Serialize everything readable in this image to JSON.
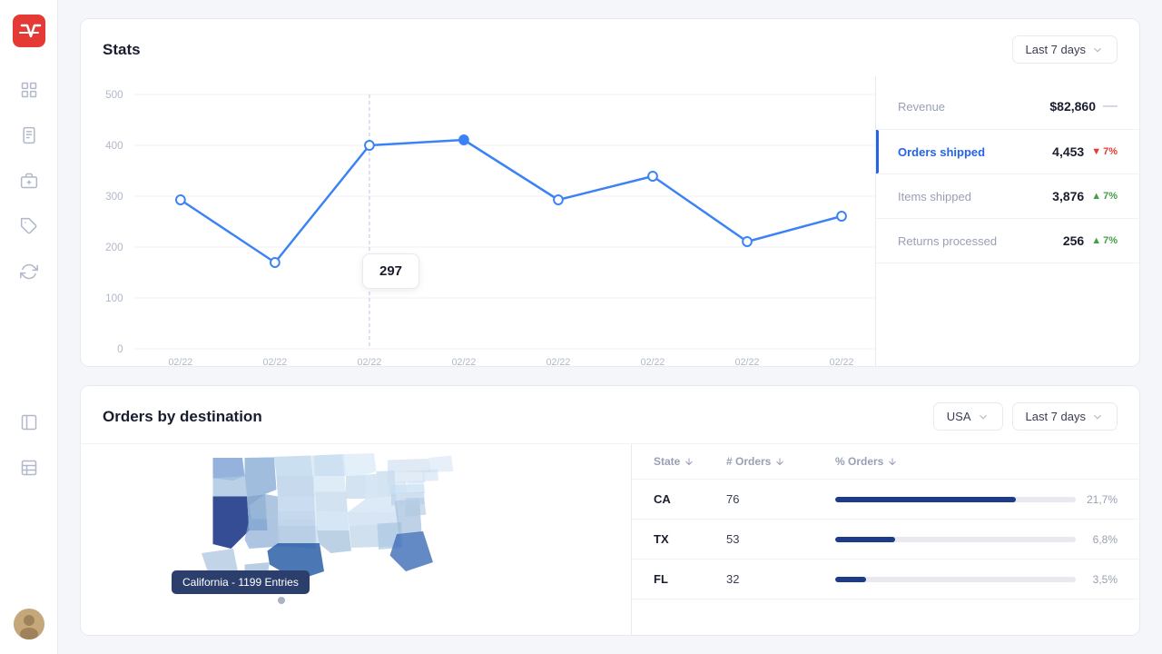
{
  "sidebar": {
    "logo_color": "#e53935",
    "items": [
      {
        "name": "dashboard-icon",
        "label": "Dashboard"
      },
      {
        "name": "orders-icon",
        "label": "Orders"
      },
      {
        "name": "inventory-icon",
        "label": "Inventory"
      },
      {
        "name": "tags-icon",
        "label": "Tags"
      },
      {
        "name": "refresh-icon",
        "label": "Sync"
      }
    ]
  },
  "stats": {
    "title": "Stats",
    "time_filter": "Last 7 days",
    "chart": {
      "y_labels": [
        "500",
        "400",
        "300",
        "200",
        "100",
        "0"
      ],
      "x_labels": [
        "02/22",
        "02/22",
        "02/22",
        "02/22",
        "02/22",
        "02/22",
        "02/22",
        "02/22"
      ],
      "data_points": [
        300,
        170,
        400,
        410,
        300,
        340,
        210,
        300,
        260
      ],
      "tooltip_value": "297",
      "tooltip_visible": true
    },
    "metrics": [
      {
        "name": "revenue",
        "label": "Revenue",
        "value": "$82,860",
        "badge": null,
        "badge_type": null,
        "active": false,
        "has_dash": true
      },
      {
        "name": "orders-shipped",
        "label": "Orders shipped",
        "value": "4,453",
        "badge": "7%",
        "badge_type": "down",
        "active": true,
        "has_dash": false
      },
      {
        "name": "items-shipped",
        "label": "Items shipped",
        "value": "3,876",
        "badge": "7%",
        "badge_type": "up",
        "active": false,
        "has_dash": false
      },
      {
        "name": "returns-processed",
        "label": "Returns processed",
        "value": "256",
        "badge": "7%",
        "badge_type": "up",
        "active": false,
        "has_dash": false
      }
    ]
  },
  "orders_by_destination": {
    "title": "Orders by destination",
    "country_filter": "USA",
    "time_filter": "Last 7 days",
    "map_tooltip": "California - 1199 Entries",
    "table": {
      "columns": [
        "State",
        "# Orders",
        "% Orders"
      ],
      "rows": [
        {
          "state": "CA",
          "orders": 76,
          "pct": 21.7,
          "pct_label": "21,7%"
        },
        {
          "state": "TX",
          "orders": 53,
          "pct": 6.8,
          "pct_label": "6,8%"
        },
        {
          "state": "FL",
          "orders": 32,
          "pct": 3.5,
          "pct_label": "3,5%"
        }
      ]
    }
  }
}
